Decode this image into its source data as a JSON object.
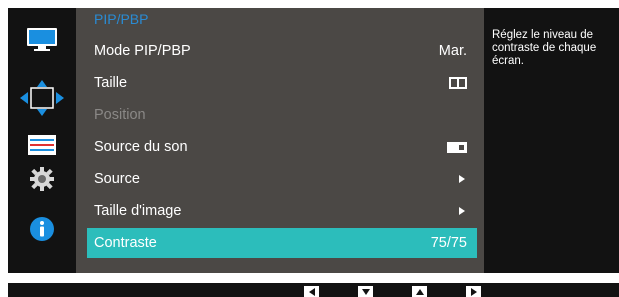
{
  "menu": {
    "title": "PIP/PBP",
    "items": [
      {
        "label": "Mode PIP/PBP",
        "value": "Mar.",
        "kind": "text"
      },
      {
        "label": "Taille",
        "value": "",
        "kind": "pip-size-icon"
      },
      {
        "label": "Position",
        "value": "",
        "kind": "disabled"
      },
      {
        "label": "Source du son",
        "value": "",
        "kind": "sound-source-icon"
      },
      {
        "label": "Source",
        "value": "",
        "kind": "submenu"
      },
      {
        "label": "Taille d'image",
        "value": "",
        "kind": "submenu"
      },
      {
        "label": "Contraste",
        "value": "75/75",
        "kind": "selected"
      }
    ]
  },
  "help_text": "Réglez le niveau de contraste de chaque écran.",
  "sidebar_icons": [
    "picture-monitor-icon",
    "onscreen-display-move-icon",
    "setup-sliders-icon",
    "system-gear-icon",
    "information-icon"
  ],
  "nav_buttons": [
    "left-arrow-button",
    "down-arrow-button",
    "up-arrow-button",
    "right-arrow-button"
  ],
  "colors": {
    "menu_bg": "#4b4845",
    "selected_bg": "#2cbdbb",
    "title": "#2a8bd3",
    "osd_bg": "#121212",
    "icon_blue": "#1a8fe0"
  }
}
